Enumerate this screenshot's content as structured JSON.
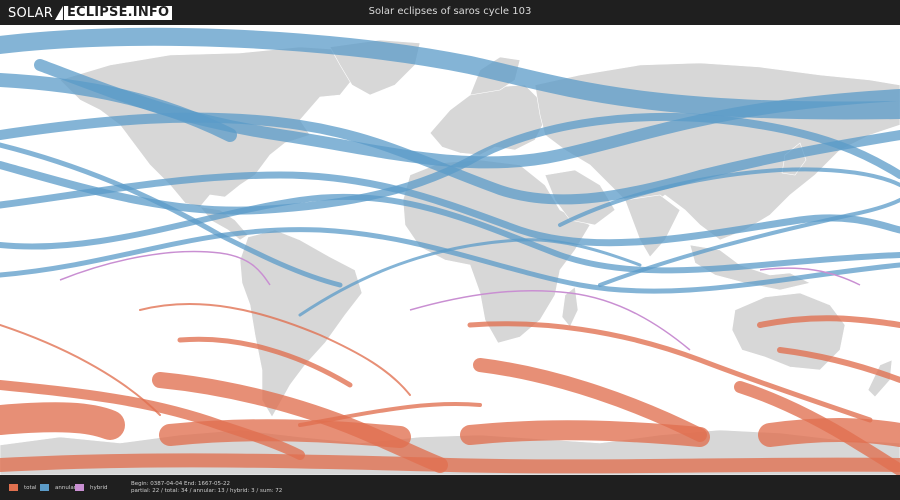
{
  "header": {
    "logo_part1": "SOLAR",
    "logo_part2": "ECLIPSE.INFO",
    "title": "Solar eclipses of saros cycle 103"
  },
  "legend": [
    {
      "label": "total",
      "color": "#e0704f"
    },
    {
      "label": "annular",
      "color": "#5b9bc8"
    },
    {
      "label": "hybrid",
      "color": "#c98fd2"
    }
  ],
  "footer": {
    "range_text": "Begin: 0387-04-04 End: 1667-05-22",
    "counts_text": "partial: 22 / total: 34 / annular: 13 / hybrid: 3 / sum: 72"
  },
  "map": {
    "land_color": "#d7d7d7",
    "ocean_color": "#ffffff",
    "annular_color": "#5b9bc8",
    "total_color": "#e0704f",
    "hybrid_color": "#c98fd2"
  }
}
